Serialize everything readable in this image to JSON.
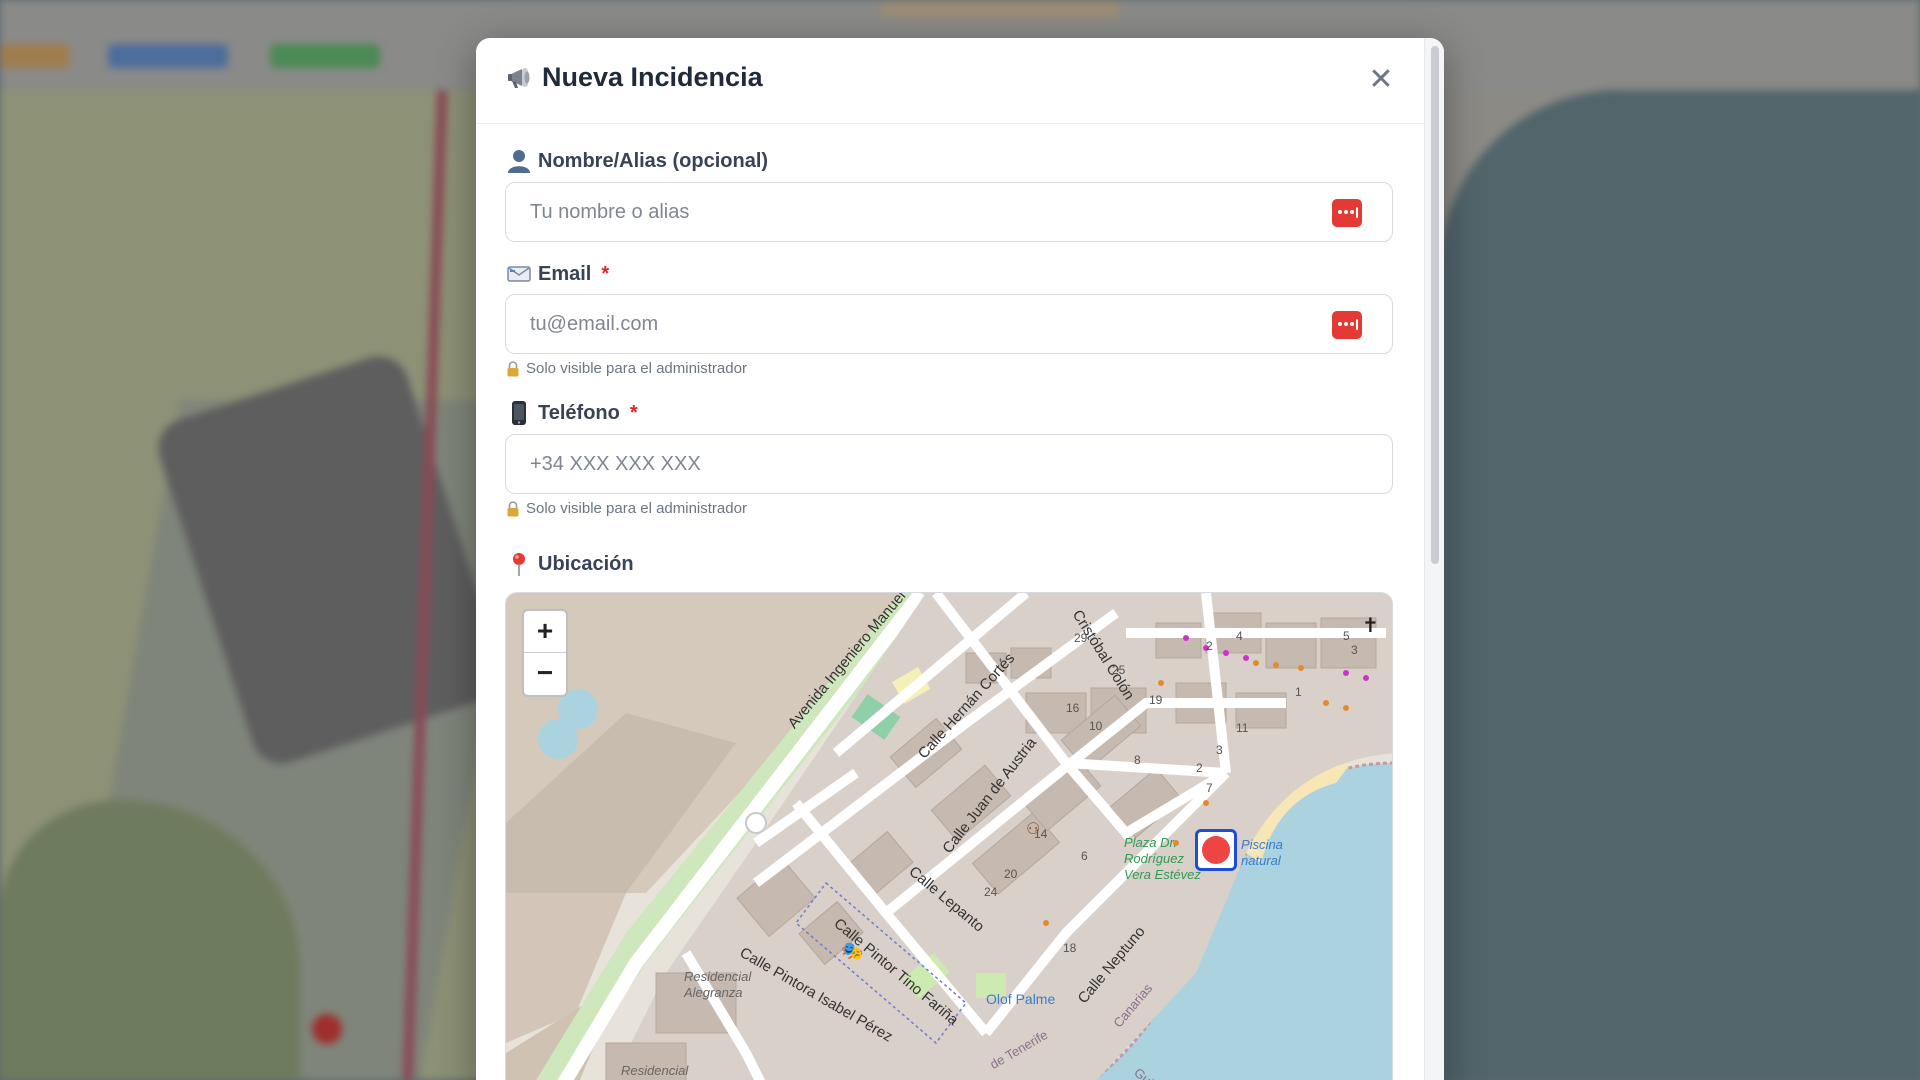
{
  "modal": {
    "title": "Nueva Incidencia",
    "title_icon": "megaphone-icon",
    "close_icon": "close-icon"
  },
  "form": {
    "name": {
      "label": "Nombre/Alias (opcional)",
      "icon": "user-icon",
      "placeholder": "Tu nombre o alias",
      "value": ""
    },
    "email": {
      "label": "Email",
      "required_mark": "*",
      "icon": "envelope-icon",
      "placeholder": "tu@email.com",
      "value": "",
      "hint": "Solo visible para el administrador"
    },
    "phone": {
      "label": "Teléfono",
      "required_mark": "*",
      "icon": "mobile-phone-icon",
      "placeholder": "+34 XXX XXX XXX",
      "value": "",
      "hint": "Solo visible para el administrador"
    },
    "location": {
      "label": "Ubicación",
      "icon": "map-pin-icon"
    }
  },
  "map": {
    "zoom_in": "+",
    "zoom_out": "−",
    "streets": [
      "Avenida Ingeniero Manuel González",
      "Cristóbal Colón",
      "Calle Hernán Cortés",
      "Calle Juan de Austria",
      "Calle Lepanto",
      "Calle Pintor Tino Fariña",
      "Calle Pintora Isabel Pérez",
      "Calle Neptuno",
      "Canarias",
      "Guimar",
      "de Tenerife"
    ],
    "places": [
      "Plaza Dr. Rodríguez Vera Estévez",
      "Piscina natural",
      "Olof Palme",
      "Residencial Alegranza",
      "Residencial"
    ],
    "house_numbers": [
      "29",
      "25",
      "19",
      "16",
      "10",
      "8",
      "4",
      "2",
      "3",
      "5",
      "1",
      "11",
      "6",
      "14",
      "20",
      "24",
      "18",
      "2",
      "3",
      "7"
    ],
    "marker_color": "#ef4444",
    "sea_color": "#aad3df",
    "land_color": "#e6e1d8"
  },
  "colors": {
    "accent_red": "#dc2626",
    "text": "#1f2a3a"
  }
}
